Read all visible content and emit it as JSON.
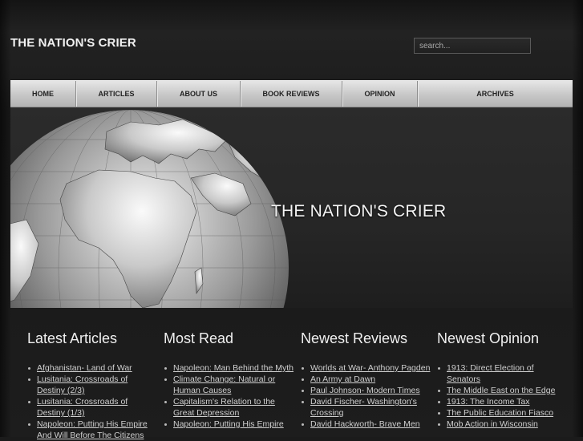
{
  "header": {
    "site_title": "THE NATION'S CRIER",
    "search_placeholder": "search..."
  },
  "nav": {
    "items": [
      {
        "label": "HOME"
      },
      {
        "label": "ARTICLES"
      },
      {
        "label": "ABOUT US"
      },
      {
        "label": "BOOK REVIEWS"
      },
      {
        "label": "OPINION"
      },
      {
        "label": "ARCHIVES"
      }
    ]
  },
  "hero": {
    "title": "THE NATION'S CRIER",
    "image": "globe-icon"
  },
  "columns": [
    {
      "heading": "Latest Articles",
      "items": [
        "Afghanistan- Land of War",
        "Lusitania: Crossroads of Destiny (2/3)",
        "Lusitania: Crossroads of Destiny (1/3)",
        "Napoleon: Putting His Empire And Will Before The Citizens"
      ]
    },
    {
      "heading": "Most Read",
      "items": [
        "Napoleon: Man Behind the Myth",
        "Climate Change: Natural or Human Causes",
        "Capitalism's Relation to the Great Depression",
        "Napoleon: Putting His Empire"
      ]
    },
    {
      "heading": "Newest Reviews",
      "items": [
        "Worlds at War- Anthony Pagden",
        "An Army at Dawn",
        "Paul Johnson- Modern Times",
        "David Fischer- Washington's Crossing",
        "David Hackworth- Brave Men"
      ]
    },
    {
      "heading": "Newest Opinion",
      "items": [
        "1913: Direct Election of Senators",
        "The Middle East on the Edge",
        "1913: The Income Tax",
        "The Public Education Fiasco",
        "Mob Action in Wisconsin"
      ]
    }
  ]
}
